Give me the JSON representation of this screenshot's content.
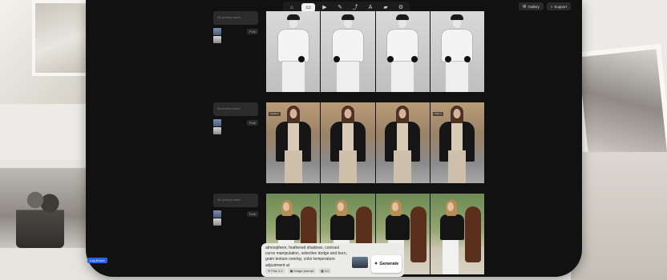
{
  "toolbar": {
    "tools": [
      "home-icon",
      "image-icon",
      "video-icon",
      "edit-icon",
      "curve-icon",
      "text-icon",
      "folder-icon",
      "settings-icon"
    ],
    "active_index": 1,
    "right_buttons": [
      {
        "icon": "gallery-icon",
        "label": "Gallery"
      },
      {
        "icon": "search-icon",
        "label": "Support"
      }
    ]
  },
  "prompt_rows": [
    {
      "placeholder": "No prompt used",
      "button": "Fork"
    },
    {
      "placeholder": "No prompt used",
      "button": "Fork"
    },
    {
      "placeholder": "No prompt used",
      "button": "Fork"
    }
  ],
  "row2_tags": [
    "Fashion",
    "",
    "",
    "Style A"
  ],
  "generate": {
    "prompt_text": "atmosphere, feathered shadows, contrast curve manipulation, selective dodge and burn, grain texture overlay, color temperature adjustment at",
    "options": [
      {
        "icon": "sparkle-icon",
        "label": "Flux 1.1"
      },
      {
        "icon": "image-icon",
        "label": "Image prompt"
      },
      {
        "icon": "grid-icon",
        "label": "4:3"
      }
    ],
    "button_label": "Generate"
  },
  "badge": "Log Errors"
}
